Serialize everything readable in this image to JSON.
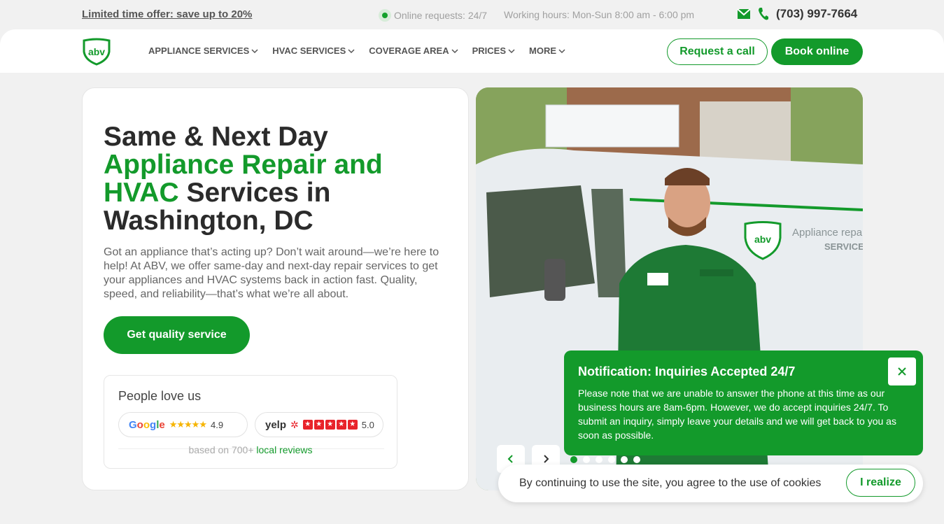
{
  "topbar": {
    "offer": "Limited time offer: save up to 20%",
    "online": "Online requests: 24/7",
    "hours": "Working hours: Mon-Sun 8:00 am - 6:00 pm",
    "phone": "(703) 997-7664"
  },
  "header": {
    "logo_text": "abv",
    "nav": [
      "APPLIANCE SERVICES",
      "HVAC SERVICES",
      "COVERAGE AREA",
      "PRICES",
      "MORE"
    ],
    "request_call": "Request a call",
    "book_online": "Book online"
  },
  "hero": {
    "title_line1": "Same & Next Day",
    "title_green": "Appliance Repair and",
    "title_green2": "HVAC",
    "title_line3": " Services in",
    "title_line4": "Washington, DC",
    "description": "Got an appliance that’s acting up? Don’t wait around—we’re here to help! At ABV, we offer same-day and next-day repair services to get your appliances and HVAC systems back in action fast. Quality, speed, and reliability—that’s what we’re all about.",
    "cta": "Get quality service"
  },
  "reviews": {
    "title": "People love us",
    "google_label": "Google",
    "google_stars": "★★★★★",
    "google_rating": "4.9",
    "yelp_label": "yelp",
    "yelp_rating": "5.0",
    "based_prefix": "based on 700+ ",
    "based_link": "local reviews"
  },
  "notification": {
    "title": "Notification: Inquiries Accepted 24/7",
    "text": "Please note that we are unable to answer the phone at this time as our business hours are 8am-6pm. However, we do accept inquiries 24/7. To submit an inquiry, simply leave your details and we will get back to you as soon as possible."
  },
  "cookie": {
    "text": "By continuing to use the site, you agree to the use of cookies",
    "button": "I realize"
  },
  "colors": {
    "accent": "#139a2b",
    "background": "#f1f1f1"
  }
}
